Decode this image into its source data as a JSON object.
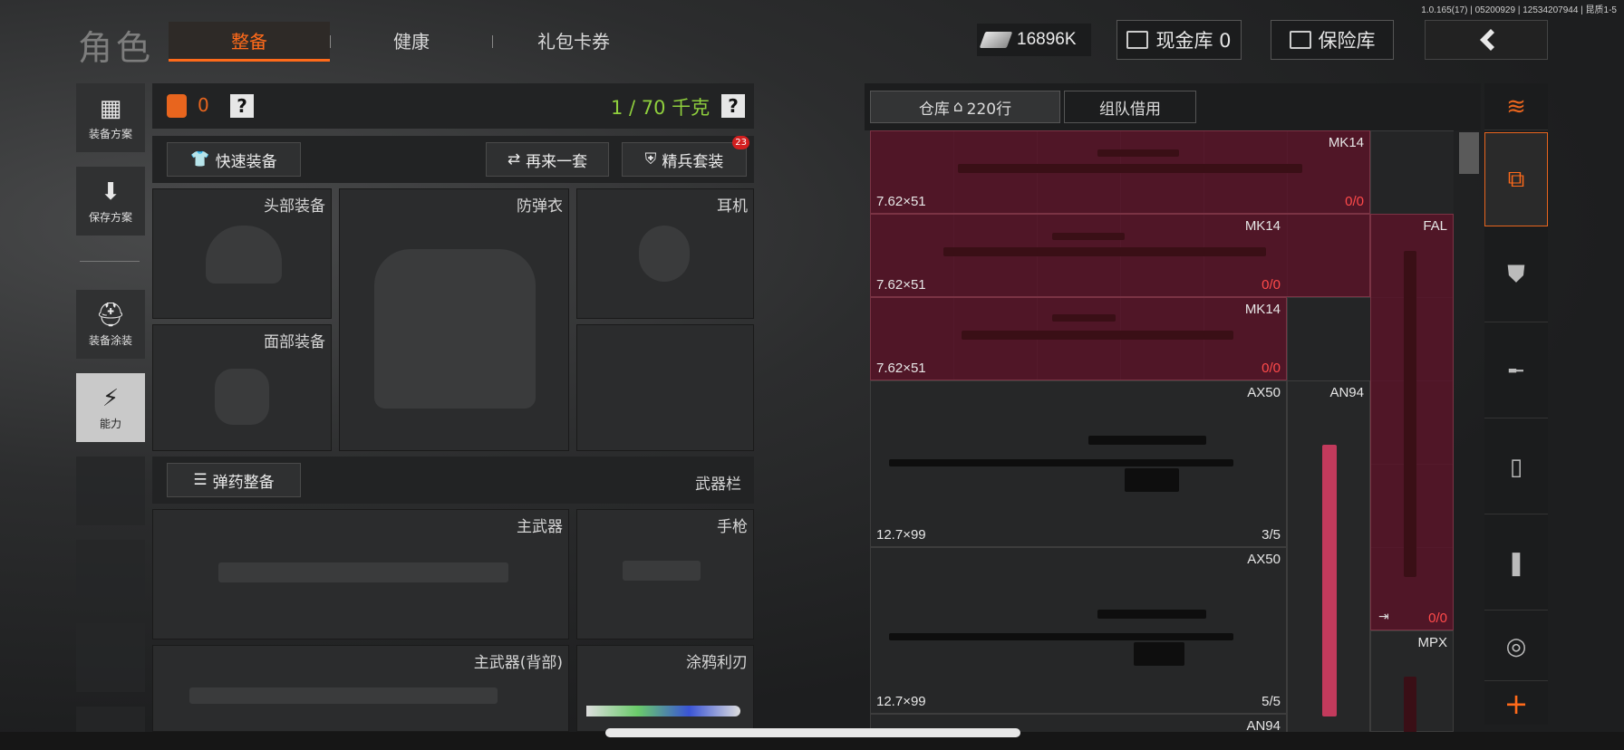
{
  "version": "1.0.165(17) | 05200929 | 12534207944 | 昆质1-5",
  "page_title": "角色",
  "tabs": [
    {
      "label": "整备",
      "active": true
    },
    {
      "label": "健康",
      "active": false
    },
    {
      "label": "礼包卡券",
      "active": false
    }
  ],
  "currency": {
    "cash": "16896K",
    "cash_vault": "现金库 0",
    "insurance": "保险库"
  },
  "sidebar": [
    {
      "label": "装备方案",
      "icon": "vest-grid-icon"
    },
    {
      "label": "保存方案",
      "icon": "download-icon"
    },
    {
      "label": "装备涂装",
      "icon": "helmet-paint-icon"
    },
    {
      "label": "能力",
      "icon": "ability-bolt-icon",
      "active": true
    }
  ],
  "equip": {
    "armor_count": "0",
    "help": "?",
    "weight": "1 / 70 千克",
    "quick_equip": "快速装备",
    "again": "再来一套",
    "elite_set": "精兵套装",
    "elite_badge": "23",
    "slots": {
      "head": "头部装备",
      "vest": "防弹衣",
      "headset": "耳机",
      "face": "面部装备",
      "primary": "主武器",
      "pistol": "手枪",
      "primary_back": "主武器(背部)",
      "melee": "涂鸦利刃"
    },
    "ammo_btn": "弹药整备",
    "weapon_bar": "武器栏"
  },
  "warehouse": {
    "tab_label": "仓库",
    "tab_rows": "220行",
    "team_borrow": "组队借用",
    "items": [
      {
        "name": "MK14",
        "caliber": "7.62×51",
        "count_a": "0",
        "count_b": "0"
      },
      {
        "name": "MK14",
        "caliber": "7.62×51",
        "count_a": "0",
        "count_b": "0"
      },
      {
        "name": "MK14",
        "caliber": "7.62×51",
        "count_a": "0",
        "count_b": "0"
      },
      {
        "name": "FAL",
        "caliber": "",
        "count_a": "0",
        "count_b": "0"
      },
      {
        "name": "AX50",
        "caliber": "12.7×99",
        "count": "3/5"
      },
      {
        "name": "AN94",
        "caliber": "",
        "count": ""
      },
      {
        "name": "AX50",
        "caliber": "12.7×99",
        "count": "5/5"
      },
      {
        "name": "MPX",
        "caliber": "",
        "count": ""
      },
      {
        "name": "AN94",
        "caliber": "",
        "count": ""
      }
    ]
  },
  "filters": [
    "stack-refresh-icon",
    "stack-box-icon",
    "armor-icon",
    "rifle-icon",
    "magazine-icon",
    "bullet-icon",
    "scope-icon",
    "plus-icon"
  ],
  "colors": {
    "accent": "#e8651e",
    "weight_green": "#8fcf3d",
    "count_red": "#ff4a4a"
  }
}
